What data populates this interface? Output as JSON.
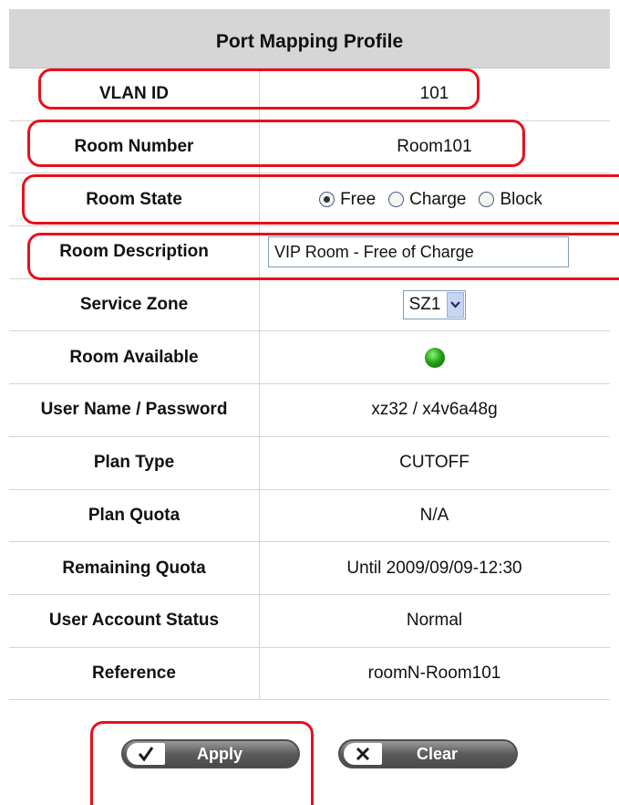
{
  "profile": {
    "title": "Port Mapping Profile",
    "rows": [
      {
        "label": "VLAN ID",
        "value": "101"
      },
      {
        "label": "Room Number",
        "value": "Room101"
      },
      {
        "label": "Room State"
      },
      {
        "label": "Room Description"
      },
      {
        "label": "Service Zone"
      },
      {
        "label": "Room Available"
      },
      {
        "label": "User Name / Password",
        "value": "xz32 / x4v6a48g"
      },
      {
        "label": "Plan Type",
        "value": "CUTOFF"
      },
      {
        "label": "Plan Quota",
        "value": "N/A"
      },
      {
        "label": "Remaining Quota",
        "value": "Until 2009/09/09-12:30"
      },
      {
        "label": "User Account Status",
        "value": "Normal"
      },
      {
        "label": "Reference",
        "value": "roomN-Room101"
      }
    ],
    "room_state": {
      "options": [
        "Free",
        "Charge",
        "Block"
      ],
      "selected": "Free"
    },
    "room_description": {
      "value": "VIP Room - Free of Charge"
    },
    "service_zone": {
      "value": "SZ1"
    },
    "room_available": {
      "status": "available",
      "color": "#26a515"
    }
  },
  "actions": {
    "apply_label": "Apply",
    "clear_label": "Clear"
  },
  "highlight_color": "#e8101a"
}
